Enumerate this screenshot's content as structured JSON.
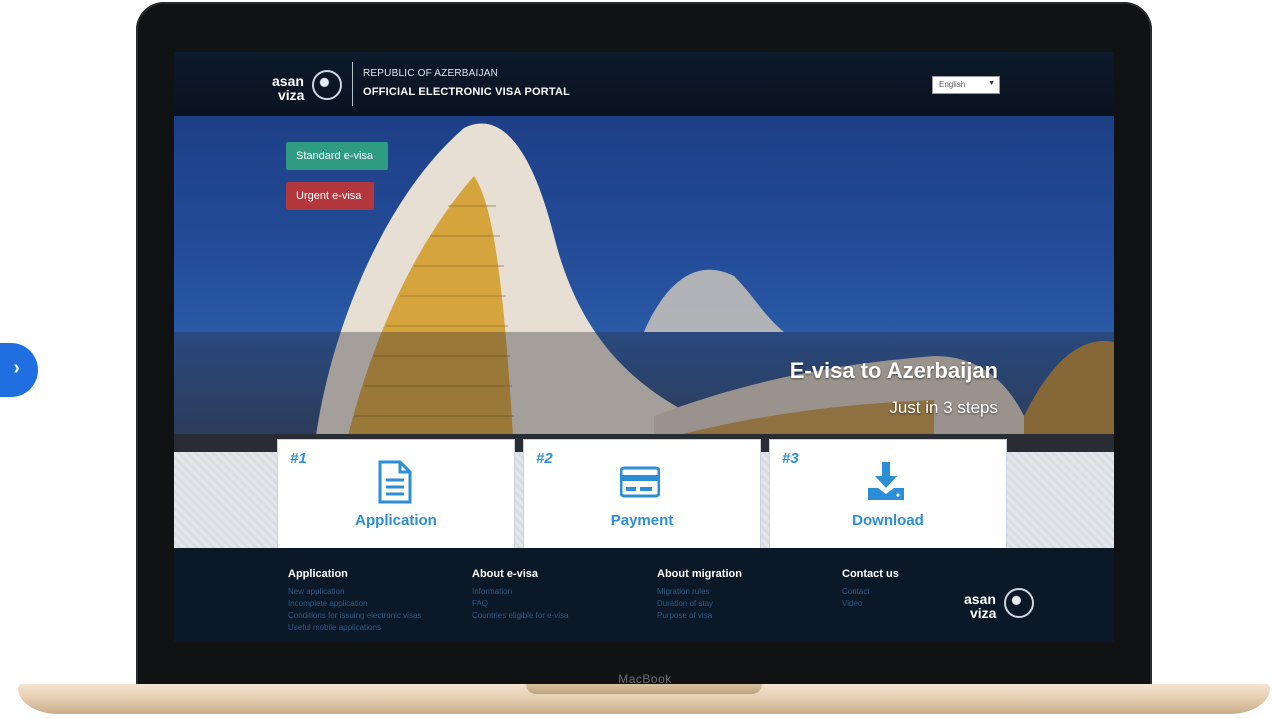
{
  "device": {
    "label": "MacBook"
  },
  "header": {
    "logo_top": "asan",
    "logo_bottom": "viza",
    "subtitle": "REPUBLIC OF AZERBAIJAN",
    "title": "OFFICIAL ELECTRONIC VISA PORTAL",
    "language": "English"
  },
  "hero": {
    "standard_button": "Standard e-visa",
    "urgent_button": "Urgent e-visa",
    "headline": "E-visa to Azerbaijan",
    "subheadline": "Just in 3 steps"
  },
  "steps": [
    {
      "number": "#1",
      "label": "Application",
      "icon": "document-icon"
    },
    {
      "number": "#2",
      "label": "Payment",
      "icon": "credit-card-icon"
    },
    {
      "number": "#3",
      "label": "Download",
      "icon": "download-icon"
    }
  ],
  "footer": {
    "columns": [
      {
        "heading": "Application",
        "links": [
          "New application",
          "Incomplete application",
          "Conditions for issuing electronic visas",
          "Useful mobile applications"
        ]
      },
      {
        "heading": "About e-visa",
        "links": [
          "Information",
          "FAQ",
          "Countries eligible for e-visa"
        ]
      },
      {
        "heading": "About migration",
        "links": [
          "Migration rules",
          "Duration of stay",
          "Purpose of visa"
        ]
      },
      {
        "heading": "Contact us",
        "links": [
          "Contact",
          "Video"
        ]
      }
    ]
  },
  "colors": {
    "standard_button": "#2e9b83",
    "urgent_button": "#b3373d",
    "step_accent": "#2c8ed6",
    "header_bg": "#0d1a2b"
  }
}
